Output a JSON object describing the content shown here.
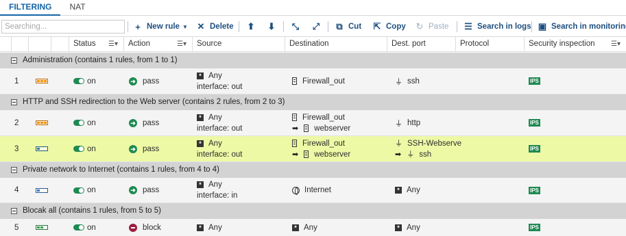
{
  "tabs": [
    {
      "label": "FILTERING",
      "active": true
    },
    {
      "label": "NAT",
      "active": false
    }
  ],
  "toolbar": {
    "search_placeholder": "Searching...",
    "new_rule": "New rule",
    "delete": "Delete",
    "cut": "Cut",
    "copy": "Copy",
    "paste": "Paste",
    "search_logs": "Search in logs",
    "search_monitoring": "Search in monitoring"
  },
  "columns": {
    "status": "Status",
    "action": "Action",
    "source": "Source",
    "destination": "Destination",
    "dest_port": "Dest. port",
    "protocol": "Protocol",
    "security_inspection": "Security inspection"
  },
  "colors": {
    "accent": "#1565a8",
    "on_green": "#1e8a52",
    "block_red": "#9c1f3f",
    "selected_row": "#eef9a6",
    "section_bg": "#d3d3d3"
  },
  "sections": [
    {
      "label": "Administration (contains 1 rules, from 1 to 1)"
    },
    {
      "label": "HTTP and SSH redirection to the Web server (contains 2 rules, from 2 to 3)"
    },
    {
      "label": "Private network to Internet (contains 1 rules, from 4 to 4)"
    },
    {
      "label": "Blocak all (contains 1 rules, from 5 to 5)"
    }
  ],
  "rules": [
    {
      "num": "1",
      "status": "on",
      "action": "pass",
      "source": "Any",
      "source_iface": "interface: out",
      "dest": "Firewall_out",
      "dest_redirect": "",
      "port": "ssh",
      "port_redirect": "",
      "inspection": "IPS"
    },
    {
      "num": "2",
      "status": "on",
      "action": "pass",
      "source": "Any",
      "source_iface": "interface: out",
      "dest": "Firewall_out",
      "dest_redirect": "webserver",
      "port": "http",
      "port_redirect": "",
      "inspection": "IPS"
    },
    {
      "num": "3",
      "status": "on",
      "action": "pass",
      "source": "Any",
      "source_iface": "interface: out",
      "dest": "Firewall_out",
      "dest_redirect": "webserver",
      "port": "SSH-Webserve",
      "port_redirect": "ssh",
      "inspection": "IPS"
    },
    {
      "num": "4",
      "status": "on",
      "action": "pass",
      "source": "Any",
      "source_iface": "interface: in",
      "dest": "Internet",
      "dest_redirect": "",
      "port": "Any",
      "port_redirect": "",
      "inspection": "IPS"
    },
    {
      "num": "5",
      "status": "on",
      "action": "block",
      "source": "Any",
      "source_iface": "",
      "dest": "Any",
      "dest_redirect": "",
      "port": "Any",
      "port_redirect": "",
      "inspection": "IPS"
    }
  ]
}
